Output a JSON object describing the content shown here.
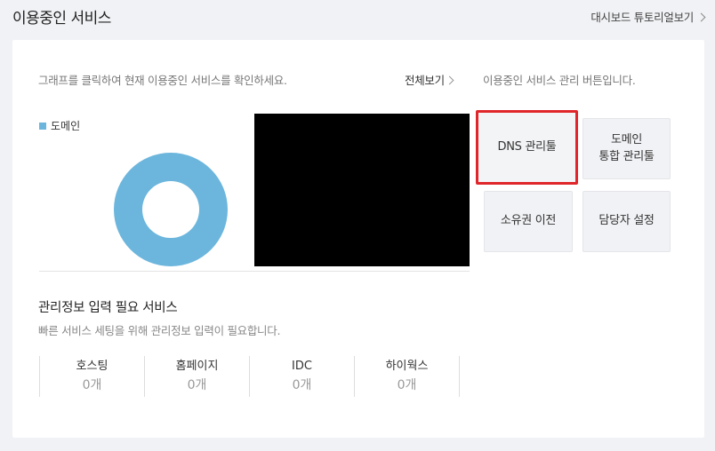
{
  "header": {
    "title": "이용중인 서비스",
    "tutorial_link": "대시보드 튜토리얼보기"
  },
  "services_panel": {
    "instruction": "그래프를 클릭하여 현재 이용중인 서비스를 확인하세요.",
    "view_all": "전체보기",
    "legend": [
      {
        "label": "도메인",
        "color": "#6cb6dd"
      }
    ]
  },
  "chart_data": {
    "type": "pie",
    "categories": [
      "도메인"
    ],
    "values": [
      1
    ],
    "colors": [
      "#6cb6dd"
    ]
  },
  "management": {
    "description": "이용중인 서비스 관리 버튼입니다.",
    "buttons": {
      "dns": "DNS 관리툴",
      "integrated_line1": "도메인",
      "integrated_line2": "통합 관리툴",
      "transfer": "소유권 이전",
      "contact": "담당자 설정"
    },
    "highlight_color": "#e0262b"
  },
  "required_info": {
    "title": "관리정보 입력 필요 서비스",
    "subtitle": "빠른 서비스 세팅을 위해 관리정보 입력이 필요합니다.",
    "items": [
      {
        "label": "호스팅",
        "count": "0개"
      },
      {
        "label": "홈페이지",
        "count": "0개"
      },
      {
        "label": "IDC",
        "count": "0개"
      },
      {
        "label": "하이웍스",
        "count": "0개"
      }
    ]
  }
}
